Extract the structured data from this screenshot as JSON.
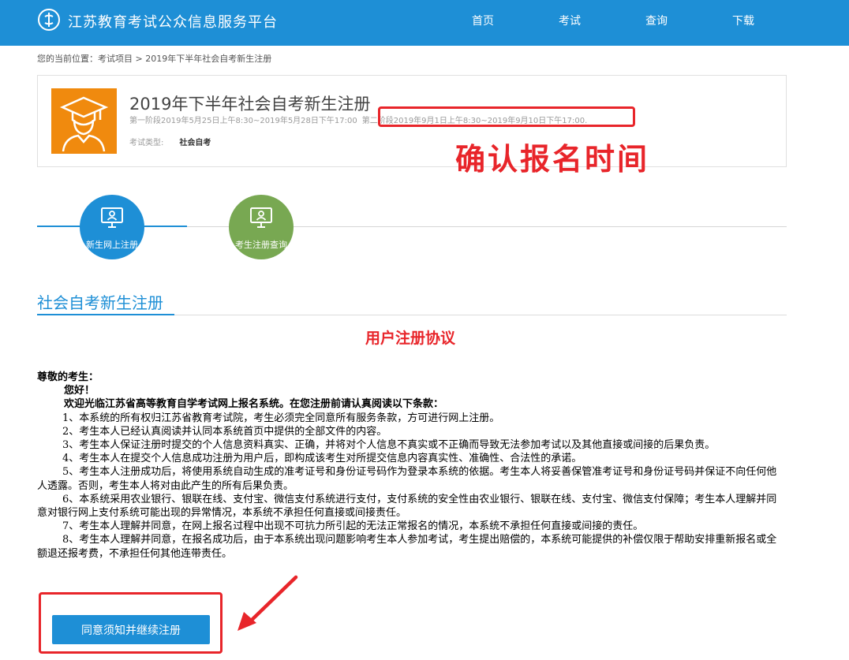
{
  "header": {
    "site_title": "江苏教育考试公众信息服务平台",
    "nav": [
      "首页",
      "考试",
      "查询",
      "下载"
    ]
  },
  "breadcrumb": "您的当前位置：考试项目 > 2019年下半年社会自考新生注册",
  "exam": {
    "title": "2019年下半年社会自考新生注册",
    "phase1": "第一阶段2019年5月25日上午8:30~2019年5月28日下午17:00",
    "phase2": "第二阶段2019年9月1日上午8:30~2019年9月10日下午17:00.",
    "type_label": "考试类型:",
    "type_value": "社会自考"
  },
  "annotation": {
    "text": "确认报名时间"
  },
  "steps": [
    {
      "label": "新生网上注册"
    },
    {
      "label": "考生注册查询"
    }
  ],
  "section": {
    "title": "社会自考新生注册",
    "agreement_title": "用户注册协议"
  },
  "agreement": {
    "greeting": "尊敬的考生：",
    "hello": "您好！",
    "intro": "欢迎光临江苏省高等教育自学考试网上报名系统。在您注册前请认真阅读以下条款：",
    "clauses": [
      "1、本系统的所有权归江苏省教育考试院，考生必须完全同意所有服务条款，方可进行网上注册。",
      "2、考生本人已经认真阅读并认同本系统首页中提供的全部文件的内容。",
      "3、考生本人保证注册时提交的个人信息资料真实、正确，并将对个人信息不真实或不正确而导致无法参加考试以及其他直接或间接的后果负责。",
      "4、考生本人在提交个人信息成功注册为用户后，即构成该考生对所提交信息内容真实性、准确性、合法性的承诺。",
      "5、考生本人注册成功后，将使用系统自动生成的准考证号和身份证号码作为登录本系统的依据。考生本人将妥善保管准考证号和身份证号码并保证不向任何他人透露。否则，考生本人将对由此产生的所有后果负责。",
      "6、本系统采用农业银行、银联在线、支付宝、微信支付系统进行支付，支付系统的安全性由农业银行、银联在线、支付宝、微信支付保障；考生本人理解并同意对银行网上支付系统可能出现的异常情况，本系统不承担任何直接或间接责任。",
      "7、考生本人理解并同意，在网上报名过程中出现不可抗力所引起的无法正常报名的情况，本系统不承担任何直接或间接的责任。",
      "8、考生本人理解并同意，在报名成功后，由于本系统出现问题影响考生本人参加考试，考生提出赔偿的，本系统可能提供的补偿仅限于帮助安排重新报名或全额退还报考费，不承担任何其他连带责任。"
    ]
  },
  "agree_button": "同意须知并继续注册",
  "colors": {
    "primary": "#1e8fd6",
    "step2": "#78a852",
    "card_icon": "#f08a0e",
    "annotation": "#e8252a"
  }
}
